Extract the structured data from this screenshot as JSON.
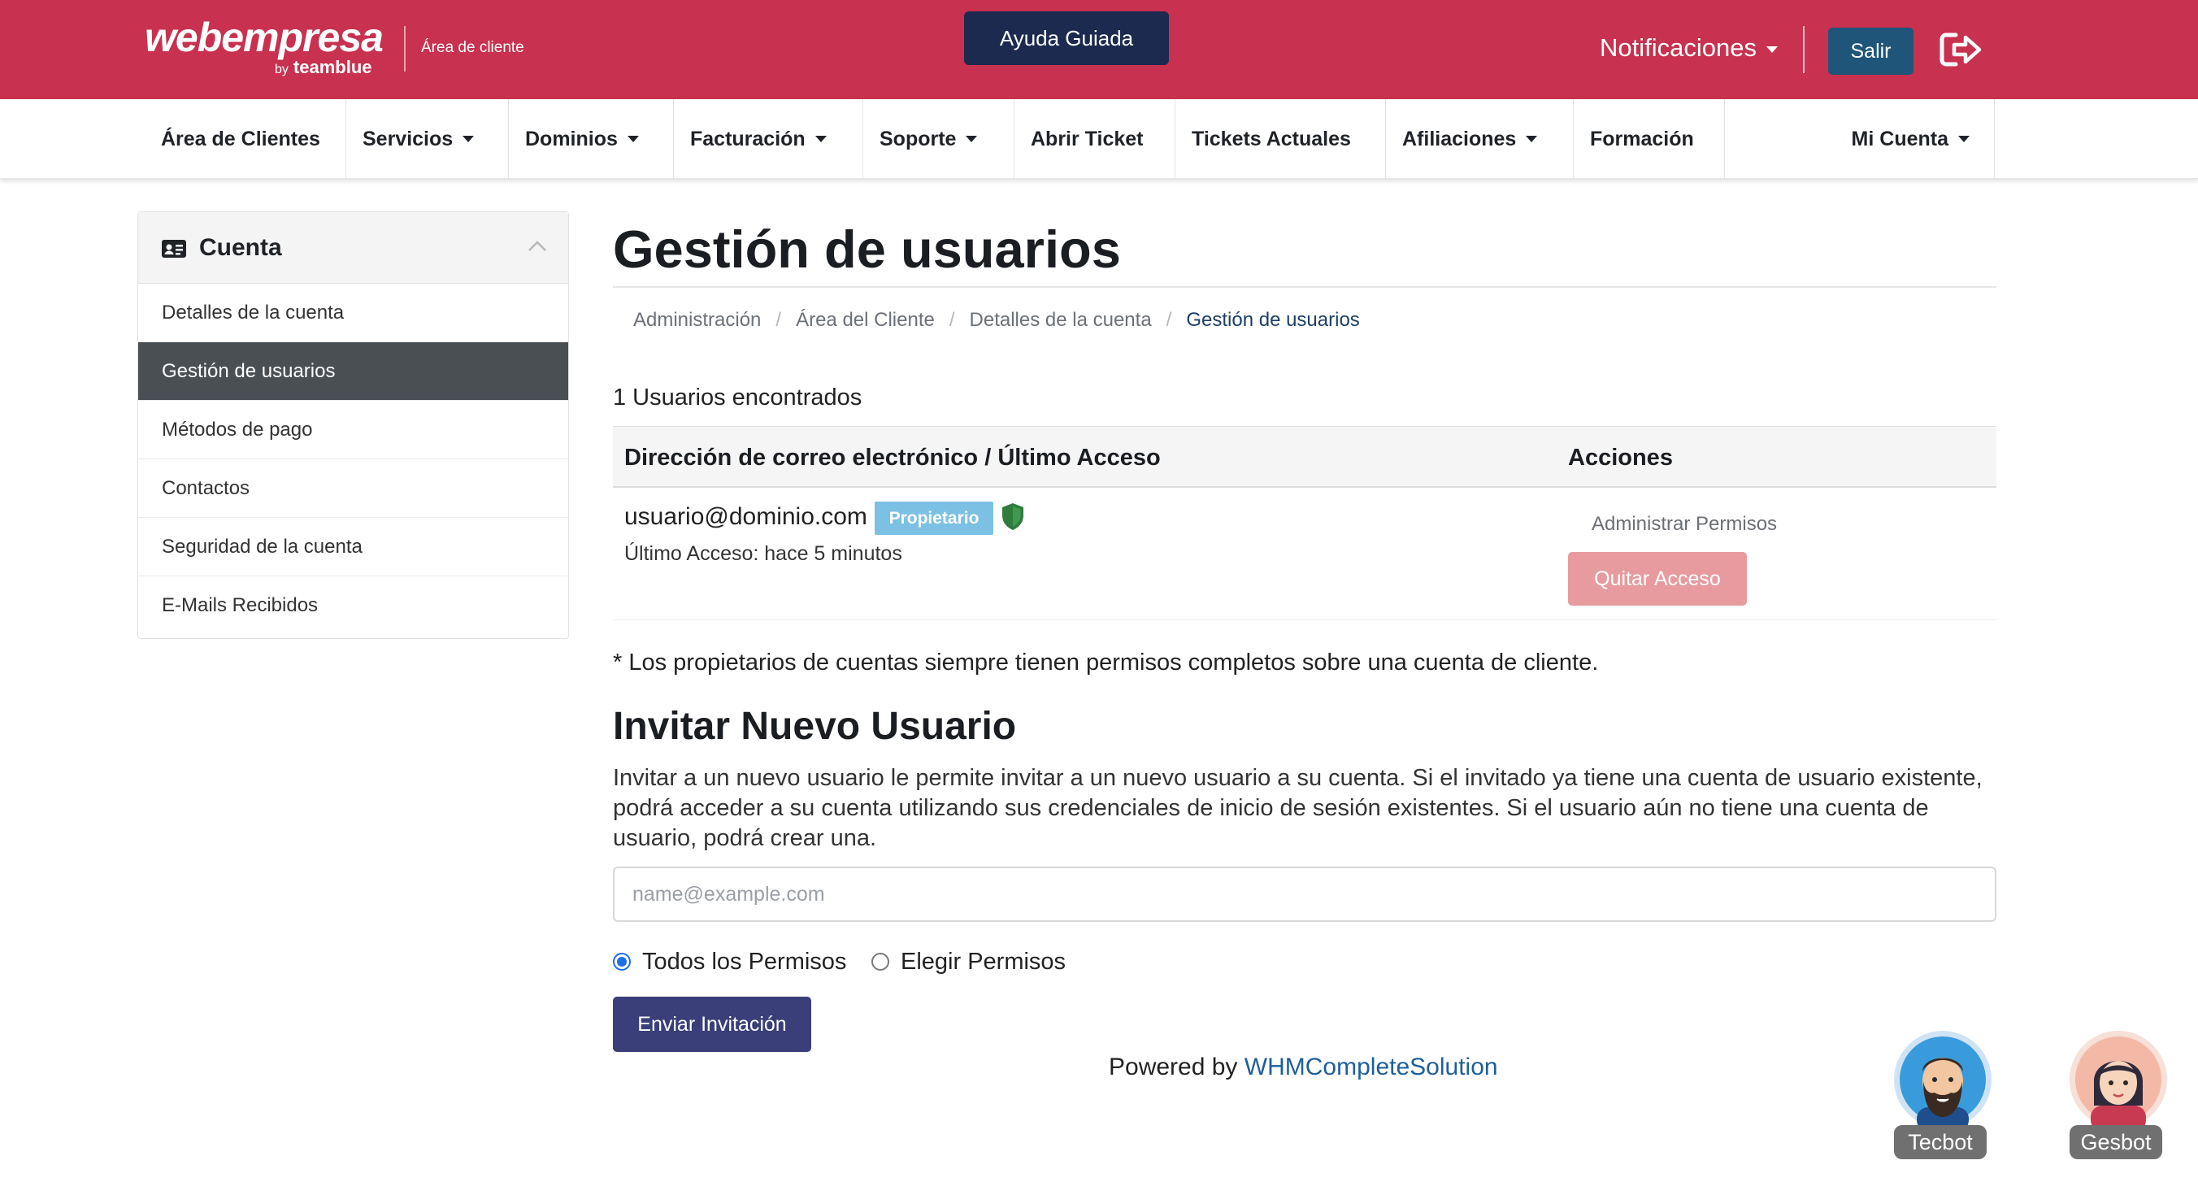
{
  "header": {
    "logo_word": "webempresa",
    "logo_by": "by",
    "logo_sub": "teamblue",
    "area_label": "Área de cliente",
    "help_button": "Ayuda Guiada",
    "notifications": "Notificaciones",
    "logout_button": "Salir",
    "logout_icon": "sign-out-icon"
  },
  "nav": {
    "items": [
      {
        "label": "Área de Clientes",
        "dropdown": false
      },
      {
        "label": "Servicios",
        "dropdown": true
      },
      {
        "label": "Dominios",
        "dropdown": true
      },
      {
        "label": "Facturación",
        "dropdown": true
      },
      {
        "label": "Soporte",
        "dropdown": true
      },
      {
        "label": "Abrir Ticket",
        "dropdown": false
      },
      {
        "label": "Tickets Actuales",
        "dropdown": false
      },
      {
        "label": "Afiliaciones",
        "dropdown": true
      },
      {
        "label": "Formación",
        "dropdown": false
      },
      {
        "label": "Mi Cuenta",
        "dropdown": true
      }
    ]
  },
  "sidebar": {
    "title": "Cuenta",
    "icon": "id-card-icon",
    "items": [
      {
        "label": "Detalles de la cuenta",
        "active": false
      },
      {
        "label": "Gestión de usuarios",
        "active": true
      },
      {
        "label": "Métodos de pago",
        "active": false
      },
      {
        "label": "Contactos",
        "active": false
      },
      {
        "label": "Seguridad de la cuenta",
        "active": false
      },
      {
        "label": "E-Mails Recibidos",
        "active": false
      }
    ]
  },
  "main": {
    "title": "Gestión de usuarios",
    "breadcrumb": [
      "Administración",
      "Área del Cliente",
      "Detalles de la cuenta",
      "Gestión de usuarios"
    ],
    "users_found": "1 Usuarios encontrados",
    "table": {
      "headers": [
        "Dirección de correo electrónico / Último Acceso",
        "Acciones"
      ],
      "rows": [
        {
          "email": "usuario@dominio.com",
          "badge": "Propietario",
          "last_access": "Último Acceso: hace 5 minutos",
          "manage_permissions": "Administrar Permisos",
          "remove_access": "Quitar Acceso"
        }
      ]
    },
    "owners_note": "* Los propietarios de cuentas siempre tienen permisos completos sobre una cuenta de cliente.",
    "invite": {
      "title": "Invitar Nuevo Usuario",
      "description": "Invitar a un nuevo usuario le permite invitar a un nuevo usuario a su cuenta. Si el invitado ya tiene una cuenta de usuario existente, podrá acceder a su cuenta utilizando sus credenciales de inicio de sesión existentes. Si el usuario aún no tiene una cuenta de usuario, podrá crear una.",
      "email_placeholder": "name@example.com",
      "email_value": "",
      "option_all": "Todos los Permisos",
      "option_choose": "Elegir Permisos",
      "selected_option": "Todos los Permisos",
      "send_button": "Enviar Invitación"
    },
    "powered_by": "Powered by",
    "powered_link": "WHMCompleteSolution"
  },
  "bots": [
    {
      "label": "Tecbot"
    },
    {
      "label": "Gesbot"
    }
  ],
  "colors": {
    "brand": "#c8314f",
    "help_button": "#1b2a4e",
    "logout_button": "#1e5578",
    "active_sidebar": "#4a4f54",
    "badge": "#7cc1e3",
    "remove_button": "#e79b9e",
    "send_button": "#3a3f7a",
    "shield": "#2f7d3e"
  }
}
